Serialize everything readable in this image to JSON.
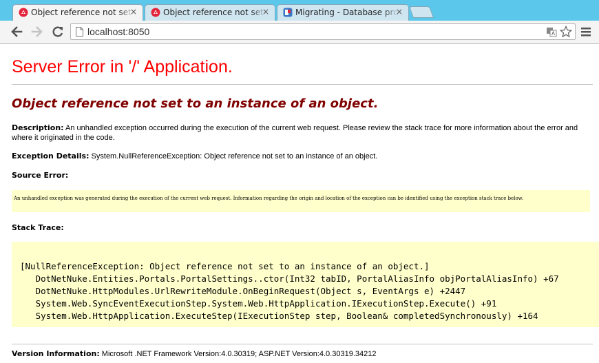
{
  "browser": {
    "tabs": [
      {
        "title": "Object reference not set to an instance of an object.",
        "close": "×"
      },
      {
        "title": "Object reference not set to an instance of an object.",
        "close": "×"
      },
      {
        "title": "Migrating - Database problem",
        "close": "×"
      }
    ],
    "address": "localhost:8050",
    "colors": {
      "tabstrip": "#5bc7ea",
      "dnn_icon": "#e4243a",
      "dnn_icon_bg": "#ffffff"
    }
  },
  "page": {
    "heading": "Server Error in '/' Application.",
    "error_title": "Object reference not set to an instance of an object.",
    "description_label": "Description:",
    "description_text": "An unhandled exception occurred during the execution of the current web request. Please review the stack trace for more information about the error and where it originated in the code.",
    "exception_label": "Exception Details:",
    "exception_text": "System.NullReferenceException: Object reference not set to an instance of an object.",
    "source_error_label": "Source Error:",
    "source_error_text": "An unhandled exception was generated during the execution of the current web request. Information regarding the origin and location of the exception can be identified using the exception stack trace below.",
    "stack_trace_label": "Stack Trace:",
    "stack_trace": "[NullReferenceException: Object reference not set to an instance of an object.]\n   DotNetNuke.Entities.Portals.PortalSettings..ctor(Int32 tabID, PortalAliasInfo objPortalAliasInfo) +67\n   DotNetNuke.HttpModules.UrlRewriteModule.OnBeginRequest(Object s, EventArgs e) +2447\n   System.Web.SyncEventExecutionStep.System.Web.HttpApplication.IExecutionStep.Execute() +91\n   System.Web.HttpApplication.ExecuteStep(IExecutionStep step, Boolean& completedSynchronously) +164",
    "version_label": "Version Information:",
    "version_text": "Microsoft .NET Framework Version:4.0.30319; ASP.NET Version:4.0.30319.34212",
    "colors": {
      "heading": "#ff0000",
      "error_title": "#800000",
      "code_bg": "#ffffcc"
    }
  }
}
